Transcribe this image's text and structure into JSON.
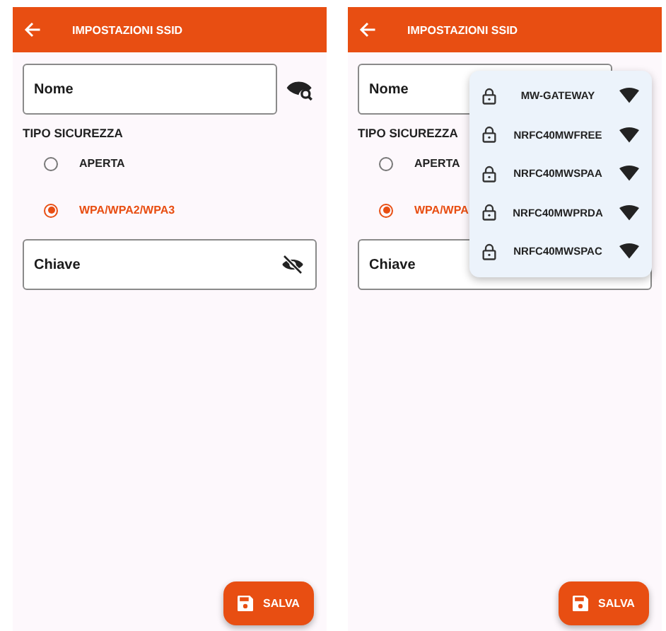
{
  "screens": [
    {
      "title": "IMPOSTAZIONI SSID",
      "name_field": {
        "label": "Nome",
        "visibility_toggle": true
      },
      "security": {
        "label": "TIPO SICUREZZA",
        "options": [
          {
            "label": "APERTA",
            "selected": false
          },
          {
            "label": "WPA/WPA2/WPA3",
            "selected": true
          }
        ]
      },
      "key_field": {
        "label": "Chiave",
        "visibility_toggle": true
      },
      "save_button": "SALVA"
    },
    {
      "title": "IMPOSTAZIONI SSID",
      "name_field": {
        "label": "Nome"
      },
      "security": {
        "label": "TIPO SICUREZZA",
        "options": [
          {
            "label": "APERTA",
            "selected": false
          },
          {
            "label": "WPA/WPA",
            "selected": true
          }
        ]
      },
      "key_field": {
        "label": "Chiave"
      },
      "save_button": "SALVA",
      "ssid_menu": [
        {
          "ssid": "MW-GATEWAY"
        },
        {
          "ssid": "NRFC40MWFREE"
        },
        {
          "ssid": "NRFC40MWSPAA"
        },
        {
          "ssid": "NRFC40MWPRDA"
        },
        {
          "ssid": "NRFC40MWSPAC"
        }
      ]
    }
  ]
}
